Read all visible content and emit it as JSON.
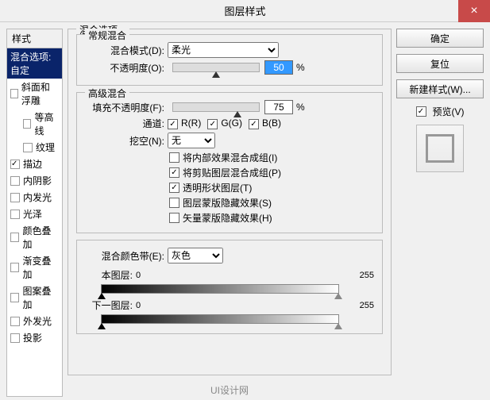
{
  "title": "图层样式",
  "close": "×",
  "sidebar": {
    "header": "样式",
    "items": [
      {
        "label": "混合选项:自定",
        "selected": true,
        "checkbox": false
      },
      {
        "label": "斜面和浮雕",
        "checked": false,
        "checkbox": true
      },
      {
        "label": "等高线",
        "checked": false,
        "checkbox": true,
        "child": true
      },
      {
        "label": "纹理",
        "checked": false,
        "checkbox": true,
        "child": true
      },
      {
        "label": "描边",
        "checked": true,
        "checkbox": true
      },
      {
        "label": "内阴影",
        "checked": false,
        "checkbox": true
      },
      {
        "label": "内发光",
        "checked": false,
        "checkbox": true
      },
      {
        "label": "光泽",
        "checked": false,
        "checkbox": true
      },
      {
        "label": "颜色叠加",
        "checked": false,
        "checkbox": true
      },
      {
        "label": "渐变叠加",
        "checked": false,
        "checkbox": true
      },
      {
        "label": "图案叠加",
        "checked": false,
        "checkbox": true
      },
      {
        "label": "外发光",
        "checked": false,
        "checkbox": true
      },
      {
        "label": "投影",
        "checked": false,
        "checkbox": true
      }
    ]
  },
  "groups": {
    "main": "混合选项",
    "normal": "常规混合",
    "advanced": "高级混合"
  },
  "normal": {
    "mode_label": "混合模式(D):",
    "mode_value": "柔光",
    "opacity_label": "不透明度(O):",
    "opacity_value": "50",
    "percent": "%"
  },
  "advanced": {
    "fill_label": "填充不透明度(F):",
    "fill_value": "75",
    "percent": "%",
    "channel_label": "通道:",
    "r": "R(R)",
    "g": "G(G)",
    "b": "B(B)",
    "knockout_label": "挖空(N):",
    "knockout_value": "无",
    "effects": [
      {
        "label": "将内部效果混合成组(I)",
        "checked": false
      },
      {
        "label": "将剪贴图层混合成组(P)",
        "checked": true
      },
      {
        "label": "透明形状图层(T)",
        "checked": true
      },
      {
        "label": "图层蒙版隐藏效果(S)",
        "checked": false
      },
      {
        "label": "矢量蒙版隐藏效果(H)",
        "checked": false
      }
    ]
  },
  "blendif": {
    "label": "混合颜色带(E):",
    "value": "灰色",
    "this_label": "本图层:",
    "this_low": "0",
    "this_high": "255",
    "under_label": "下一图层:",
    "under_low": "0",
    "under_high": "255"
  },
  "buttons": {
    "ok": "确定",
    "reset": "复位",
    "newstyle": "新建样式(W)...",
    "preview": "预览(V)"
  },
  "logo": "UI设计网"
}
